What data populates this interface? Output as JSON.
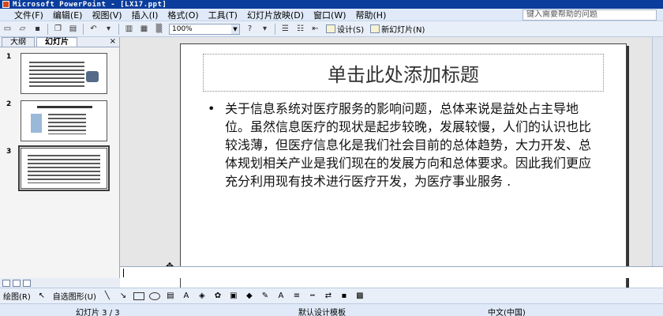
{
  "window": {
    "title": "Microsoft PowerPoint - [LX17.ppt]"
  },
  "menu": {
    "items": [
      "文件(F)",
      "编辑(E)",
      "视图(V)",
      "插入(I)",
      "格式(O)",
      "工具(T)",
      "幻灯片放映(D)",
      "窗口(W)",
      "帮助(H)"
    ],
    "help_placeholder": "键入需要帮助的问题"
  },
  "toolbar": {
    "zoom": "100%",
    "design_label": "设计(S)",
    "new_slide_label": "新幻灯片(N)"
  },
  "left_pane": {
    "tabs": [
      "大纲",
      "幻灯片"
    ],
    "active_tab": "幻灯片",
    "close": "×",
    "thumbnails": [
      {
        "number": "1"
      },
      {
        "number": "2"
      },
      {
        "number": "3"
      }
    ]
  },
  "slide": {
    "title_placeholder": "单击此处添加标题",
    "bullet": "•",
    "body": "关于信息系统对医疗服务的影响问题，总体来说是益处占主导地位。虽然信息医疗的现状是起步较晚，发展较慢，人们的认识也比较浅薄，但医疗信息化是我们社会目前的总体趋势，大力开发、总体规划相关产业是我们现在的发展方向和总体要求。因此我们更应充分利用现有技术进行医疗开发，为医疗事业服务 ."
  },
  "drawing_toolbar": {
    "draw_label": "绘图(R)",
    "autoshapes_label": "自选图形(U)"
  },
  "status": {
    "slide_position": "幻灯片 3 / 3",
    "design_template": "默认设计模板",
    "language": "中文(中国)"
  }
}
